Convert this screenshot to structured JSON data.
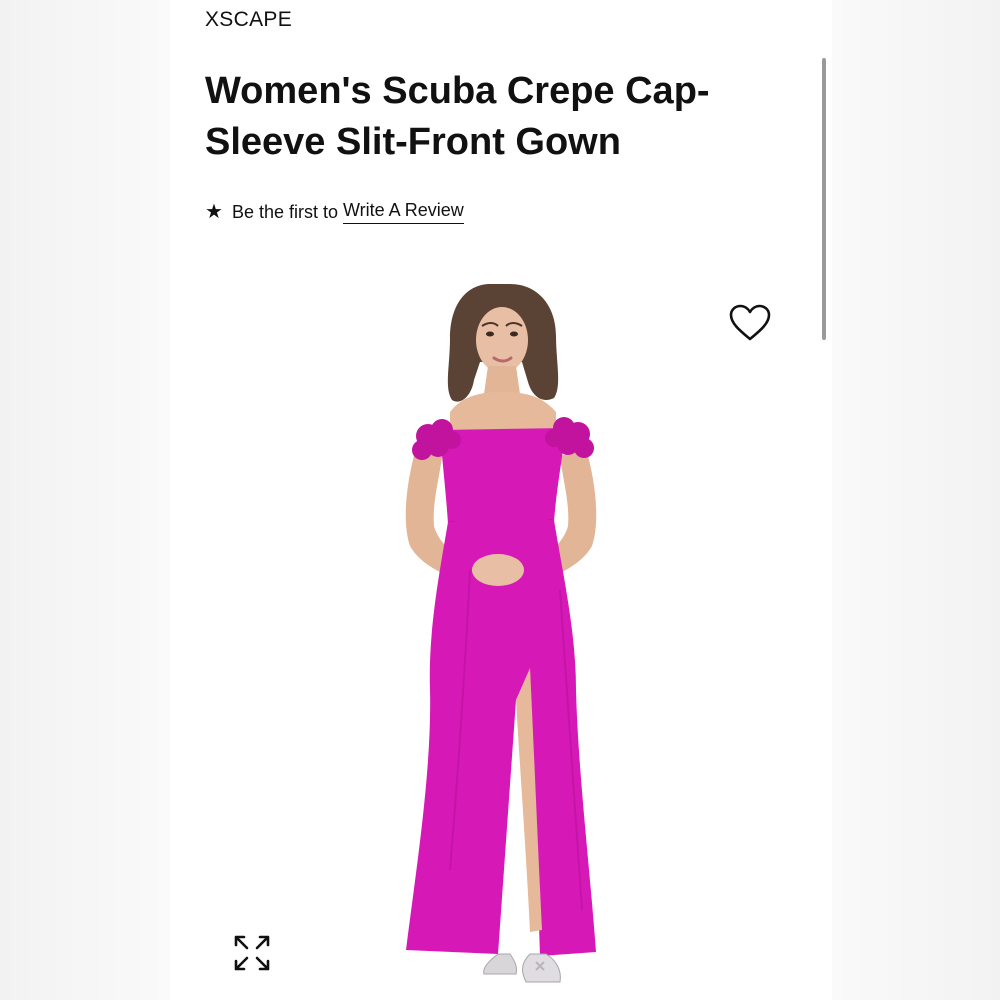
{
  "product": {
    "brand": "XSCAPE",
    "title": "Women's Scuba Crepe Cap-Sleeve Slit-Front Gown",
    "review": {
      "prompt": "Be the first to",
      "link_label": "Write A Review"
    },
    "image": {
      "dress_color": "#d619b6",
      "subject": "model in off-shoulder fuchsia gown with rosette cap sleeves and front slit"
    }
  },
  "icons": {
    "star": "star-icon",
    "wishlist": "heart-icon",
    "expand": "expand-icon"
  }
}
